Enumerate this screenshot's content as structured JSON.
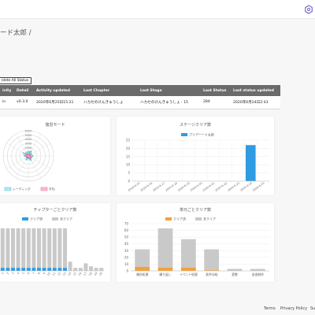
{
  "header": {
    "title": "ード太郎 /",
    "settings_icon": "settings-icon"
  },
  "toolbar": {
    "delete_all_label": "elete All Status"
  },
  "table": {
    "columns": [
      "ivity",
      "Detail",
      "Activity updated",
      "Last Chapter",
      "Last Stage",
      "Last Status",
      "Last status updated"
    ],
    "rows": [
      [
        "in",
        "v0.3.0",
        "2020年6月25日15:21",
        "ハカセのけんきゅうしょ",
        "ハカセのけんきゅうしょ - 15",
        "284",
        "2020年6月24日2:43"
      ]
    ]
  },
  "charts": {
    "radar": {
      "title": "復習モード",
      "legend": [
        "レーディング",
        "平均"
      ],
      "colors": {
        "series1": "#4fc3d6",
        "series2": "#f06292"
      }
    },
    "stage": {
      "title": "ステージクリア数",
      "legend": [
        "プリアーード太郎"
      ],
      "color": "#2f9be3"
    },
    "chapter": {
      "title": "チャプターごとクリア数",
      "legend": [
        "クリア済",
        "未クリア"
      ],
      "colors": {
        "cleared": "#2f9be3",
        "uncleared": "#c9c9c9"
      }
    },
    "unit": {
      "title": "単元ごとクリア数",
      "legend": [
        "クリア済",
        "未クリア"
      ],
      "colors": {
        "cleared": "#f5a03a",
        "uncleared": "#c9c9c9"
      }
    }
  },
  "chart_data": [
    {
      "type": "radar",
      "title": "復習モード",
      "axis_ticks": [
        "1000",
        "2000",
        "3000",
        "4000",
        "5000",
        "6000"
      ],
      "series": [
        {
          "name": "レーディング",
          "values": [
            900,
            1300,
            700,
            1100,
            800,
            1200,
            600,
            1000,
            500,
            900,
            1400,
            700
          ]
        },
        {
          "name": "平均",
          "values": [
            400,
            700,
            300,
            600,
            500,
            800,
            400,
            500,
            300,
            600,
            700,
            400
          ]
        }
      ],
      "rlim": [
        0,
        6000
      ]
    },
    {
      "type": "bar",
      "title": "ステージクリア数",
      "categories": [
        "2020-6-15",
        "2020-6-16",
        "2020-6-17",
        "2020-6-18",
        "2020-6-19",
        "2020-6-20",
        "2020-6-21",
        "2020-6-22",
        "2020-6-23",
        "2020-6-24",
        "2020-6-25"
      ],
      "series": [
        {
          "name": "プリアーード太郎",
          "values": [
            0,
            0,
            0,
            0,
            0,
            0,
            0,
            0,
            0,
            22,
            0
          ]
        }
      ],
      "ylim": [
        0,
        25
      ],
      "yticks": [
        0,
        5,
        10,
        15,
        20,
        25
      ]
    },
    {
      "type": "bar",
      "title": "チャプターごとクリア数",
      "categories": [
        "1",
        "2",
        "3",
        "4",
        "5",
        "6",
        "7",
        "8",
        "9",
        "10",
        "11",
        "12",
        "13",
        "14",
        "15",
        "16",
        "17",
        "18",
        "19",
        "20"
      ],
      "series": [
        {
          "name": "クリア済",
          "values": [
            2,
            2,
            2,
            2,
            2,
            2,
            2,
            2,
            2,
            2,
            2,
            2,
            2,
            0,
            0,
            0,
            0,
            0,
            0,
            0
          ]
        },
        {
          "name": "未クリア",
          "values": [
            26,
            26,
            26,
            26,
            26,
            26,
            26,
            26,
            26,
            26,
            26,
            26,
            26,
            6,
            2,
            2,
            5,
            3,
            2,
            2
          ]
        }
      ],
      "stacked": true
    },
    {
      "type": "bar",
      "title": "単元ごとクリア数",
      "categories": [
        "順次処理",
        "繰り返し",
        "イベント処理",
        "条件分岐",
        "変数",
        "自由制作"
      ],
      "series": [
        {
          "name": "クリア済",
          "values": [
            6,
            5,
            5,
            1,
            0,
            0
          ]
        },
        {
          "name": "未クリア",
          "values": [
            26,
            58,
            42,
            31,
            3,
            3
          ]
        }
      ],
      "stacked": true,
      "ylim": [
        0,
        70
      ],
      "yticks": [
        0,
        10,
        20,
        30,
        40,
        50,
        60,
        70
      ]
    }
  ],
  "footer": {
    "links": [
      "Terms",
      "Privacy Policy",
      "Su"
    ]
  }
}
